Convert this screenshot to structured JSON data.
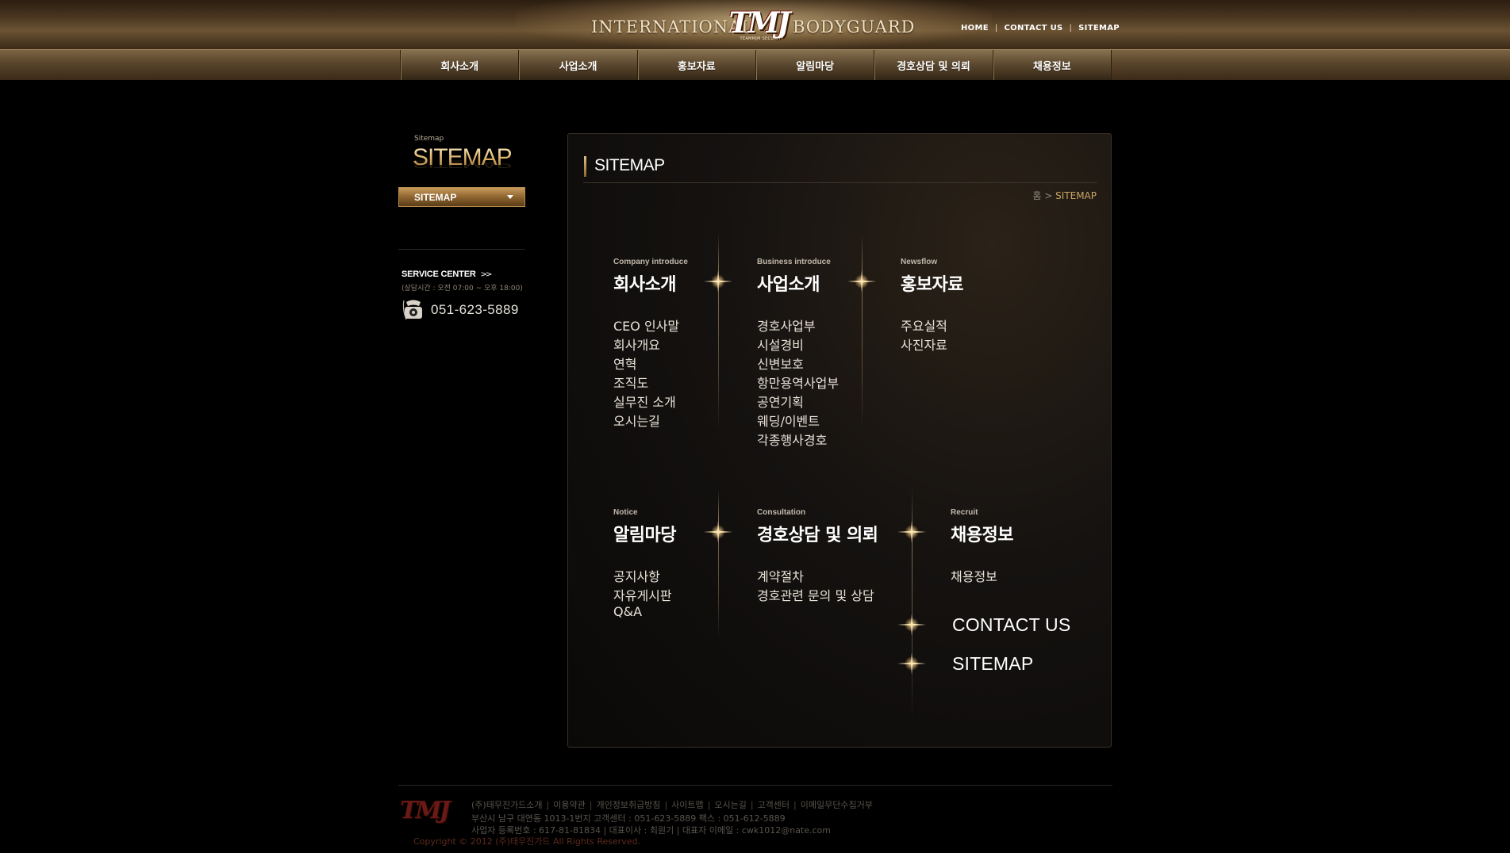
{
  "header": {
    "logo_left": "INTERNATIONAL",
    "logo_mark": "TMJ",
    "logo_mark_sub": "TEAMMJM SECURITY",
    "logo_right": "BODYGUARD",
    "top_links": [
      {
        "label": "HOME"
      },
      {
        "label": "CONTACT US"
      },
      {
        "label": "SITEMAP"
      }
    ],
    "top_link_separator": "|"
  },
  "gnb": {
    "items": [
      {
        "label": "회사소개"
      },
      {
        "label": "사업소개"
      },
      {
        "label": "홍보자료"
      },
      {
        "label": "알림마당"
      },
      {
        "label": "경호상담 및 의뢰"
      },
      {
        "label": "채용정보"
      }
    ]
  },
  "lnb": {
    "subtitle": "Sitemap",
    "title": "SITEMAP",
    "menu_label": "SITEMAP",
    "service": {
      "title": "SERVICE CENTER",
      "arrow": ">>",
      "hours": "(상담시간 : 오전 07:00 ~ 오후 18:00)",
      "phone": "051-623-5889"
    }
  },
  "main": {
    "title": "SITEMAP",
    "breadcrumb": {
      "home": "홈",
      "separator": ">",
      "current": "SITEMAP"
    },
    "groups": [
      {
        "en": "Company introduce",
        "ko": "회사소개",
        "items": [
          "CEO 인사말",
          "회사개요",
          "연혁",
          "조직도",
          "실무진 소개",
          "오시는길"
        ]
      },
      {
        "en": "Business introduce",
        "ko": "사업소개",
        "items": [
          "경호사업부",
          "시설경비",
          "신변보호",
          "항만용역사업부",
          "공연기획",
          "웨딩/이벤트",
          "각종행사경호"
        ]
      },
      {
        "en": "Newsflow",
        "ko": "홍보자료",
        "items": [
          "주요실적",
          "사진자료"
        ]
      },
      {
        "en": "Notice",
        "ko": "알림마당",
        "items": [
          "공지사항",
          "자유게시판",
          "Q&A"
        ]
      },
      {
        "en": "Consultation",
        "ko": "경호상담 및 의뢰",
        "items": [
          "계약절차",
          "경호관련 문의 및 상담"
        ]
      },
      {
        "en": "Recruit",
        "ko": "채용정보",
        "items": [
          "채용정보"
        ]
      }
    ],
    "extra_links": [
      {
        "label": "CONTACT US"
      },
      {
        "label": "SITEMAP"
      }
    ]
  },
  "footer": {
    "logo": "TMJ",
    "links": [
      "(주)태무진가드소개",
      "이용약관",
      "개인정보취급방침",
      "사이트맵",
      "오시는길",
      "고객센터",
      "이메일무단수집거부"
    ],
    "address": "부산시 남구 대연동 1013-1번지 고객센터 : 051-623-5889 팩스 : 051-612-5889",
    "business": "사업자 등록번호 : 617-81-81834 | 대표이사 : 최원기 | 대표자 이메일 : cwk1012@nate.com",
    "copyright": "Copyright © 2012 (주)태무진가드 All Rights Reserved."
  },
  "colors": {
    "accent_gold": "#c9a565",
    "gnb_bar": "#5c472c",
    "footer_copy": "#5d2a1c"
  }
}
